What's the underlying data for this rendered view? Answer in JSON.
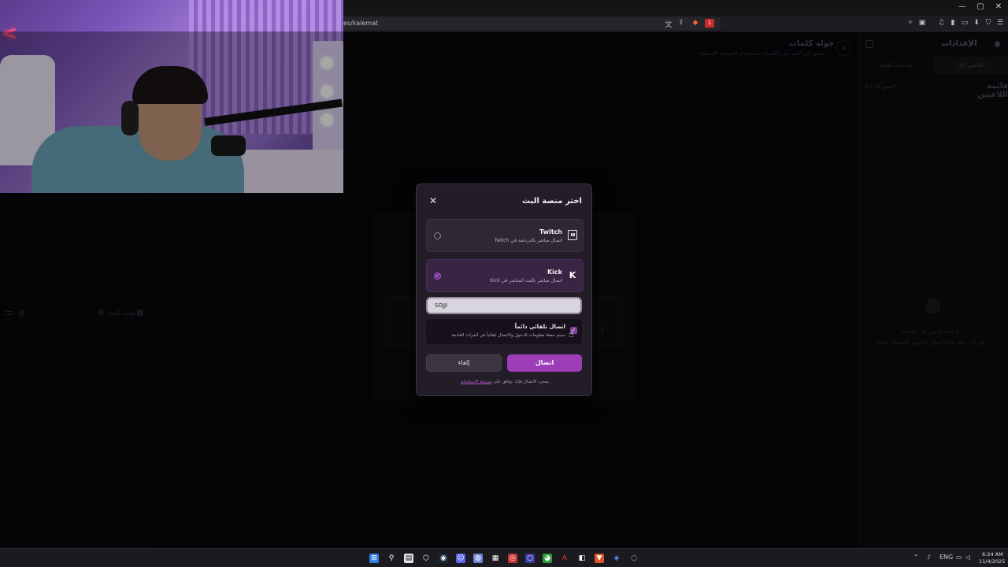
{
  "window": {
    "minimize": "—",
    "maximize": "▢",
    "close": "✕"
  },
  "browser": {
    "url": "es/kalemat",
    "alert_badge": "1"
  },
  "app": {
    "settings_title": "الإعدادات",
    "tabs": [
      "اللاعبين (0)",
      "إعدادات اللعبة"
    ],
    "players_title": "قائمة اللاعبين",
    "players_count": "0 / 16 لاعبين",
    "empty_line1": "لا يوجد لاعبين في القائمة",
    "empty_line2": "يمكن للاعبين الانضمام بكتابة !join في الدردشة",
    "game_title": "جوله كلمات",
    "game_sub": "سابق في البث من الكلمات باستخدام الحروف المعطاة",
    "chat_label": "شات البث",
    "row_number": "1"
  },
  "modal": {
    "title": "اختر منصة البث",
    "close_icon": "✕",
    "options": [
      {
        "name": "Twitch",
        "desc": "اتصال مباشر بالدردشة في Twitch",
        "selected": false,
        "icon": "twitch-icon"
      },
      {
        "name": "Kick",
        "desc": "اتصال مباشر بالبث المباشر في Kick",
        "selected": true,
        "icon": "kick-icon"
      }
    ],
    "channel_input": "SOJJI",
    "auto_connect": {
      "title": "اتصال تلقائي دائماً",
      "desc": "سيتم حفظ معلومات الدخول والاتصال تلقائياً في المرات القادمة",
      "checked": true
    },
    "connect_button": "اتصال",
    "cancel_button": "إلغاء",
    "terms_prefix": "بمجرد الاتصال فإنك توافق على",
    "terms_link": "شروط الاستخدام",
    "accent_color": "#9d3db8"
  },
  "taskbar": {
    "lang": "ENG",
    "time": "6:24 AM",
    "date": "11/4/2025"
  }
}
